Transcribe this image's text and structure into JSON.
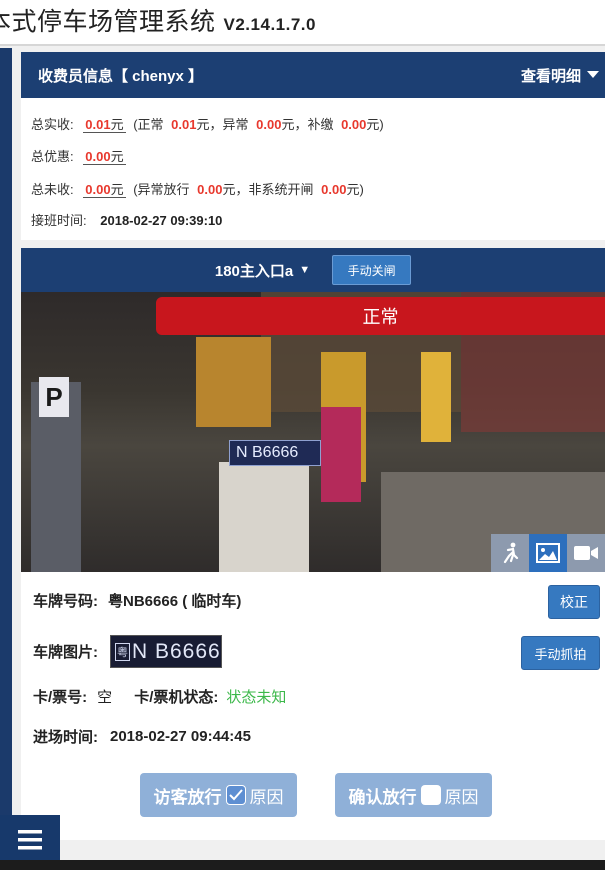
{
  "app": {
    "title": "本式停车场管理系统",
    "version": "V2.14.1.7.0"
  },
  "cashier": {
    "header": "收费员信息【 chenyx 】",
    "detail_label": "查看明细",
    "total_received_label": "总实收:",
    "total_received": "0.01",
    "yuan": "元",
    "normal_label": "(正常",
    "normal": "0.01",
    "abnormal_label": "元，异常",
    "abnormal": "0.00",
    "supplement_label": "元，补缴",
    "supplement": "0.00",
    "close_paren": "元)",
    "discount_label": "总优惠:",
    "discount": "0.00",
    "unpaid_label": "总未收:",
    "unpaid": "0.00",
    "abnormal_release_label": "(异常放行",
    "abnormal_release": "0.00",
    "nonsystem_label": "元，非系统开闸",
    "nonsystem": "0.00",
    "shift_label": "接班时间:",
    "shift_time": "2018-02-27 09:39:10"
  },
  "gate": {
    "name": "180主入口a",
    "dropdown_glyph": "▼",
    "manual_close": "手动关闸",
    "camera_status": "正常",
    "camera_plate_text": "N B6666",
    "plate_no_label": "车牌号码:",
    "plate_no": "粤NB6666 ( 临时车)",
    "correct_button": "校正",
    "plate_image_label": "车牌图片:",
    "plate_image_prefix": "粤",
    "plate_image_text": "N B6666",
    "manual_capture_button": "手动抓拍",
    "card_no_label": "卡/票号:",
    "card_no": "空",
    "card_machine_label": "卡/票机状态:",
    "card_machine_status": "状态未知",
    "entry_time_label": "进场时间:",
    "entry_time": "2018-02-27 09:44:45",
    "visitor_release": "访客放行",
    "confirm_release": "确认放行",
    "reason": "原因"
  },
  "icons": {
    "person": "person-walking-icon",
    "image": "image-icon",
    "video": "video-camera-icon",
    "menu": "hamburger-menu-icon",
    "detail_caret": "caret-down-icon",
    "check": "check-icon"
  },
  "colors": {
    "header_bg": "#1c3f73",
    "amount_red": "#e8382d",
    "status_green": "#3cb84a",
    "button_blue": "#3679c0",
    "banner_red": "#c8161d"
  }
}
